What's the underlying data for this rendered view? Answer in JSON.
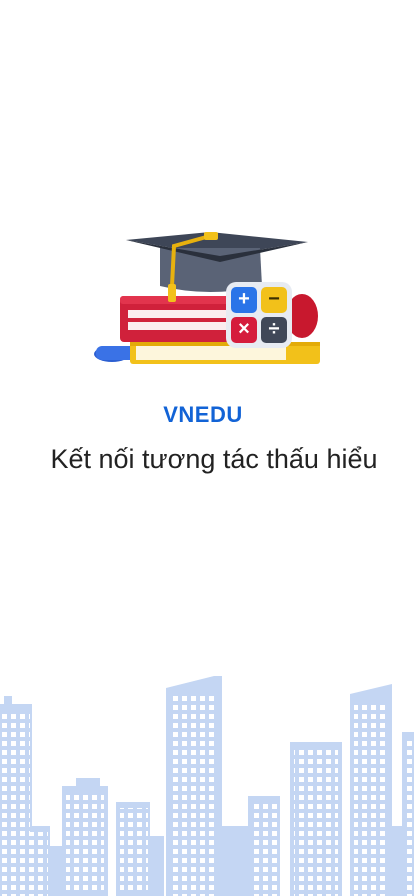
{
  "splash": {
    "app_name": "VNEDU",
    "tagline": "Kết nối tương tác thấu hiểu"
  },
  "illustration": {
    "icon": "graduation-books-calculator-icon",
    "calculator_keys": [
      "+",
      "−",
      "×",
      "÷"
    ]
  },
  "background": {
    "icon": "city-skyline-illustration"
  },
  "colors": {
    "brand_blue": "#1263d6",
    "text_dark": "#222222",
    "skyline_blue": "#c4d6f3",
    "window_white": "#ffffff",
    "background": "#ffffff"
  }
}
